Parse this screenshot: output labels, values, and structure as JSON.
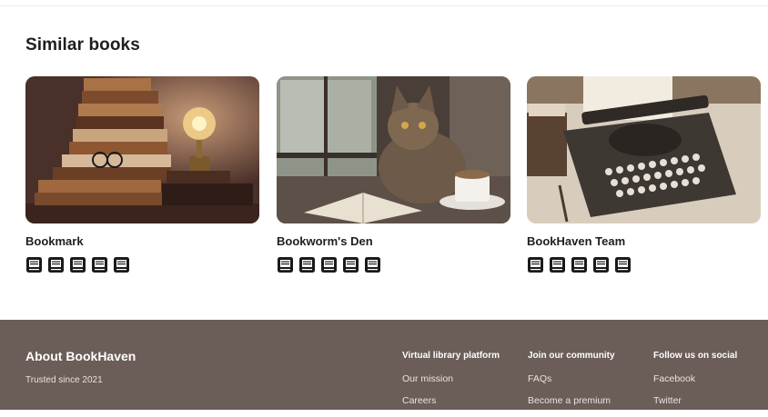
{
  "similar": {
    "title": "Similar books",
    "books": [
      {
        "title": "Bookmark",
        "image": "stack-of-books-with-lightbulb",
        "rating": 5
      },
      {
        "title": "Bookworm's Den",
        "image": "cat-by-window-with-book-and-coffee",
        "rating": 5
      },
      {
        "title": "BookHaven Team",
        "image": "vintage-typewriter",
        "rating": 5
      }
    ],
    "rating_icon": "book-icon"
  },
  "footer": {
    "about_title": "About BookHaven",
    "about_subtitle": "Trusted since 2021",
    "columns": [
      {
        "title": "Virtual library platform",
        "links": [
          "Our mission",
          "Careers"
        ]
      },
      {
        "title": "Join our community",
        "links": [
          "FAQs",
          "Become a premium"
        ]
      },
      {
        "title": "Follow us on social",
        "links": [
          "Facebook",
          "Twitter"
        ]
      }
    ]
  },
  "colors": {
    "footer_bg": "#6b5d57",
    "text_dark": "#1e1e1e"
  }
}
